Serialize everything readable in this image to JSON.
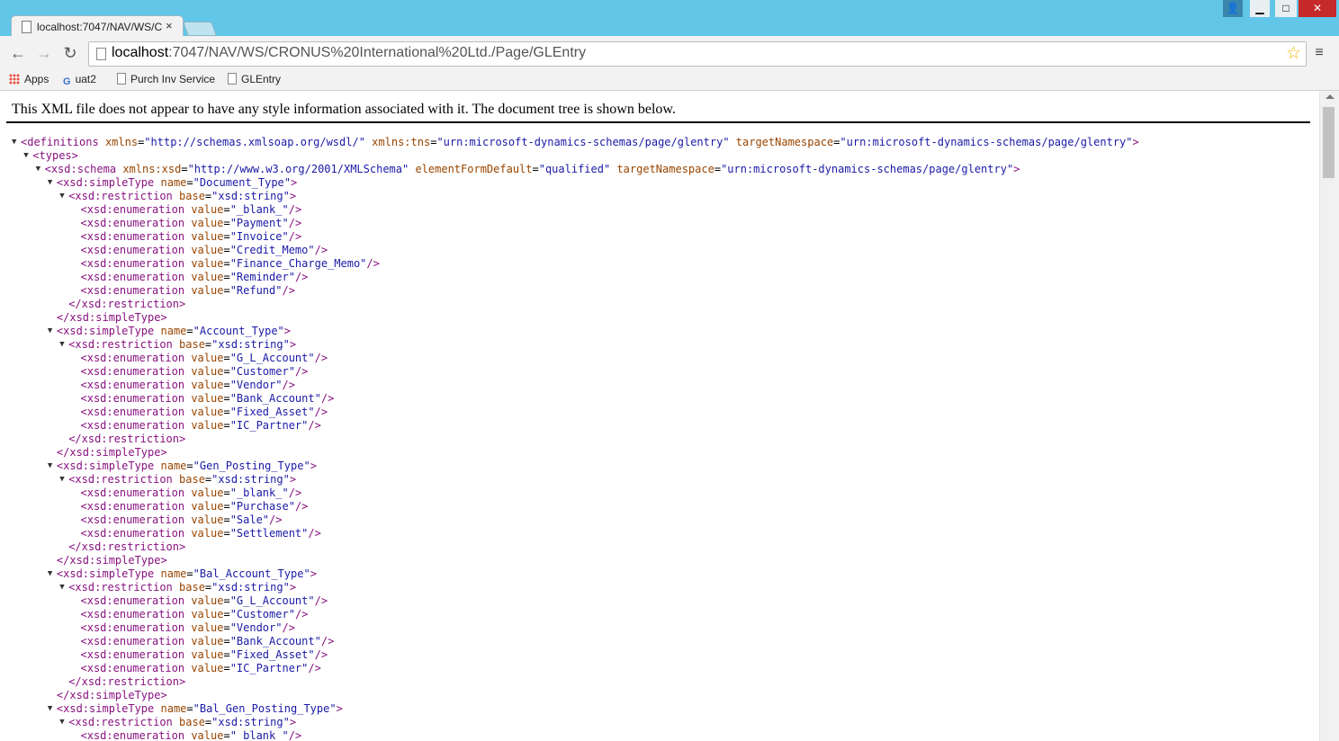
{
  "tab": {
    "title": "localhost:7047/NAV/WS/C",
    "close": "×"
  },
  "window": {
    "user": "👤",
    "minimize": "▁",
    "maximize": "□",
    "close": "✕"
  },
  "toolbar": {
    "back": "←",
    "forward": "→",
    "reload": "↻",
    "url_host": "localhost",
    "url_rest": ":7047/NAV/WS/CRONUS%20International%20Ltd./Page/GLEntry",
    "star": "☆",
    "menu": "≡"
  },
  "bookmarks": [
    {
      "label": "Apps",
      "icon": "apps-icon"
    },
    {
      "label": "uat2",
      "icon": "g-icon"
    },
    {
      "label": "Purch Inv Service",
      "icon": "page-icon"
    },
    {
      "label": "GLEntry",
      "icon": "page-icon"
    }
  ],
  "info_text": "This XML file does not appear to have any style information associated with it. The document tree is shown below.",
  "xml_lines": [
    {
      "level": 0,
      "expand": true,
      "html": "<span class='tag'>&lt;definitions</span> <span class='an'>xmlns</span>=<span class='av'>\"http://schemas.xmlsoap.org/wsdl/\"</span> <span class='an'>xmlns:tns</span>=<span class='av'>\"urn:microsoft-dynamics-schemas/page/glentry\"</span> <span class='an'>targetNamespace</span>=<span class='av'>\"urn:microsoft-dynamics-schemas/page/glentry\"</span><span class='tag'>&gt;</span>"
    },
    {
      "level": 1,
      "expand": true,
      "html": "<span class='tag'>&lt;types&gt;</span>"
    },
    {
      "level": 2,
      "expand": true,
      "html": "<span class='tag'>&lt;xsd:schema</span> <span class='an'>xmlns:xsd</span>=<span class='av'>\"http://www.w3.org/2001/XMLSchema\"</span> <span class='an'>elementFormDefault</span>=<span class='av'>\"qualified\"</span> <span class='an'>targetNamespace</span>=<span class='av'>\"urn:microsoft-dynamics-schemas/page/glentry\"</span><span class='tag'>&gt;</span>"
    },
    {
      "level": 3,
      "expand": true,
      "html": "<span class='tag'>&lt;xsd:simpleType</span> <span class='an'>name</span>=<span class='av'>\"Document_Type\"</span><span class='tag'>&gt;</span>"
    },
    {
      "level": 4,
      "expand": true,
      "html": "<span class='tag'>&lt;xsd:restriction</span> <span class='an'>base</span>=<span class='av'>\"xsd:string\"</span><span class='tag'>&gt;</span>"
    },
    {
      "level": 5,
      "expand": false,
      "html": "<span class='tag'>&lt;xsd:enumeration</span> <span class='an'>value</span>=<span class='av'>\"_blank_\"</span><span class='tag'>/&gt;</span>"
    },
    {
      "level": 5,
      "expand": false,
      "html": "<span class='tag'>&lt;xsd:enumeration</span> <span class='an'>value</span>=<span class='av'>\"Payment\"</span><span class='tag'>/&gt;</span>"
    },
    {
      "level": 5,
      "expand": false,
      "html": "<span class='tag'>&lt;xsd:enumeration</span> <span class='an'>value</span>=<span class='av'>\"Invoice\"</span><span class='tag'>/&gt;</span>"
    },
    {
      "level": 5,
      "expand": false,
      "html": "<span class='tag'>&lt;xsd:enumeration</span> <span class='an'>value</span>=<span class='av'>\"Credit_Memo\"</span><span class='tag'>/&gt;</span>"
    },
    {
      "level": 5,
      "expand": false,
      "html": "<span class='tag'>&lt;xsd:enumeration</span> <span class='an'>value</span>=<span class='av'>\"Finance_Charge_Memo\"</span><span class='tag'>/&gt;</span>"
    },
    {
      "level": 5,
      "expand": false,
      "html": "<span class='tag'>&lt;xsd:enumeration</span> <span class='an'>value</span>=<span class='av'>\"Reminder\"</span><span class='tag'>/&gt;</span>"
    },
    {
      "level": 5,
      "expand": false,
      "html": "<span class='tag'>&lt;xsd:enumeration</span> <span class='an'>value</span>=<span class='av'>\"Refund\"</span><span class='tag'>/&gt;</span>"
    },
    {
      "level": 4,
      "expand": false,
      "html": "<span class='tag'>&lt;/xsd:restriction&gt;</span>"
    },
    {
      "level": 3,
      "expand": false,
      "html": "<span class='tag'>&lt;/xsd:simpleType&gt;</span>"
    },
    {
      "level": 3,
      "expand": true,
      "html": "<span class='tag'>&lt;xsd:simpleType</span> <span class='an'>name</span>=<span class='av'>\"Account_Type\"</span><span class='tag'>&gt;</span>"
    },
    {
      "level": 4,
      "expand": true,
      "html": "<span class='tag'>&lt;xsd:restriction</span> <span class='an'>base</span>=<span class='av'>\"xsd:string\"</span><span class='tag'>&gt;</span>"
    },
    {
      "level": 5,
      "expand": false,
      "html": "<span class='tag'>&lt;xsd:enumeration</span> <span class='an'>value</span>=<span class='av'>\"G_L_Account\"</span><span class='tag'>/&gt;</span>"
    },
    {
      "level": 5,
      "expand": false,
      "html": "<span class='tag'>&lt;xsd:enumeration</span> <span class='an'>value</span>=<span class='av'>\"Customer\"</span><span class='tag'>/&gt;</span>"
    },
    {
      "level": 5,
      "expand": false,
      "html": "<span class='tag'>&lt;xsd:enumeration</span> <span class='an'>value</span>=<span class='av'>\"Vendor\"</span><span class='tag'>/&gt;</span>"
    },
    {
      "level": 5,
      "expand": false,
      "html": "<span class='tag'>&lt;xsd:enumeration</span> <span class='an'>value</span>=<span class='av'>\"Bank_Account\"</span><span class='tag'>/&gt;</span>"
    },
    {
      "level": 5,
      "expand": false,
      "html": "<span class='tag'>&lt;xsd:enumeration</span> <span class='an'>value</span>=<span class='av'>\"Fixed_Asset\"</span><span class='tag'>/&gt;</span>"
    },
    {
      "level": 5,
      "expand": false,
      "html": "<span class='tag'>&lt;xsd:enumeration</span> <span class='an'>value</span>=<span class='av'>\"IC_Partner\"</span><span class='tag'>/&gt;</span>"
    },
    {
      "level": 4,
      "expand": false,
      "html": "<span class='tag'>&lt;/xsd:restriction&gt;</span>"
    },
    {
      "level": 3,
      "expand": false,
      "html": "<span class='tag'>&lt;/xsd:simpleType&gt;</span>"
    },
    {
      "level": 3,
      "expand": true,
      "html": "<span class='tag'>&lt;xsd:simpleType</span> <span class='an'>name</span>=<span class='av'>\"Gen_Posting_Type\"</span><span class='tag'>&gt;</span>"
    },
    {
      "level": 4,
      "expand": true,
      "html": "<span class='tag'>&lt;xsd:restriction</span> <span class='an'>base</span>=<span class='av'>\"xsd:string\"</span><span class='tag'>&gt;</span>"
    },
    {
      "level": 5,
      "expand": false,
      "html": "<span class='tag'>&lt;xsd:enumeration</span> <span class='an'>value</span>=<span class='av'>\"_blank_\"</span><span class='tag'>/&gt;</span>"
    },
    {
      "level": 5,
      "expand": false,
      "html": "<span class='tag'>&lt;xsd:enumeration</span> <span class='an'>value</span>=<span class='av'>\"Purchase\"</span><span class='tag'>/&gt;</span>"
    },
    {
      "level": 5,
      "expand": false,
      "html": "<span class='tag'>&lt;xsd:enumeration</span> <span class='an'>value</span>=<span class='av'>\"Sale\"</span><span class='tag'>/&gt;</span>"
    },
    {
      "level": 5,
      "expand": false,
      "html": "<span class='tag'>&lt;xsd:enumeration</span> <span class='an'>value</span>=<span class='av'>\"Settlement\"</span><span class='tag'>/&gt;</span>"
    },
    {
      "level": 4,
      "expand": false,
      "html": "<span class='tag'>&lt;/xsd:restriction&gt;</span>"
    },
    {
      "level": 3,
      "expand": false,
      "html": "<span class='tag'>&lt;/xsd:simpleType&gt;</span>"
    },
    {
      "level": 3,
      "expand": true,
      "html": "<span class='tag'>&lt;xsd:simpleType</span> <span class='an'>name</span>=<span class='av'>\"Bal_Account_Type\"</span><span class='tag'>&gt;</span>"
    },
    {
      "level": 4,
      "expand": true,
      "html": "<span class='tag'>&lt;xsd:restriction</span> <span class='an'>base</span>=<span class='av'>\"xsd:string\"</span><span class='tag'>&gt;</span>"
    },
    {
      "level": 5,
      "expand": false,
      "html": "<span class='tag'>&lt;xsd:enumeration</span> <span class='an'>value</span>=<span class='av'>\"G_L_Account\"</span><span class='tag'>/&gt;</span>"
    },
    {
      "level": 5,
      "expand": false,
      "html": "<span class='tag'>&lt;xsd:enumeration</span> <span class='an'>value</span>=<span class='av'>\"Customer\"</span><span class='tag'>/&gt;</span>"
    },
    {
      "level": 5,
      "expand": false,
      "html": "<span class='tag'>&lt;xsd:enumeration</span> <span class='an'>value</span>=<span class='av'>\"Vendor\"</span><span class='tag'>/&gt;</span>"
    },
    {
      "level": 5,
      "expand": false,
      "html": "<span class='tag'>&lt;xsd:enumeration</span> <span class='an'>value</span>=<span class='av'>\"Bank_Account\"</span><span class='tag'>/&gt;</span>"
    },
    {
      "level": 5,
      "expand": false,
      "html": "<span class='tag'>&lt;xsd:enumeration</span> <span class='an'>value</span>=<span class='av'>\"Fixed_Asset\"</span><span class='tag'>/&gt;</span>"
    },
    {
      "level": 5,
      "expand": false,
      "html": "<span class='tag'>&lt;xsd:enumeration</span> <span class='an'>value</span>=<span class='av'>\"IC_Partner\"</span><span class='tag'>/&gt;</span>"
    },
    {
      "level": 4,
      "expand": false,
      "html": "<span class='tag'>&lt;/xsd:restriction&gt;</span>"
    },
    {
      "level": 3,
      "expand": false,
      "html": "<span class='tag'>&lt;/xsd:simpleType&gt;</span>"
    },
    {
      "level": 3,
      "expand": true,
      "html": "<span class='tag'>&lt;xsd:simpleType</span> <span class='an'>name</span>=<span class='av'>\"Bal_Gen_Posting_Type\"</span><span class='tag'>&gt;</span>"
    },
    {
      "level": 4,
      "expand": true,
      "html": "<span class='tag'>&lt;xsd:restriction</span> <span class='an'>base</span>=<span class='av'>\"xsd:string\"</span><span class='tag'>&gt;</span>"
    },
    {
      "level": 5,
      "expand": false,
      "html": "<span class='tag'>&lt;xsd:enumeration</span> <span class='an'>value</span>=<span class='av'>\"_blank_\"</span><span class='tag'>/&gt;</span>"
    }
  ],
  "colors": {
    "titlebar": "#62c6e8",
    "tag": "#881280",
    "attr_name": "#994500",
    "attr_value": "#1a1aa6"
  }
}
